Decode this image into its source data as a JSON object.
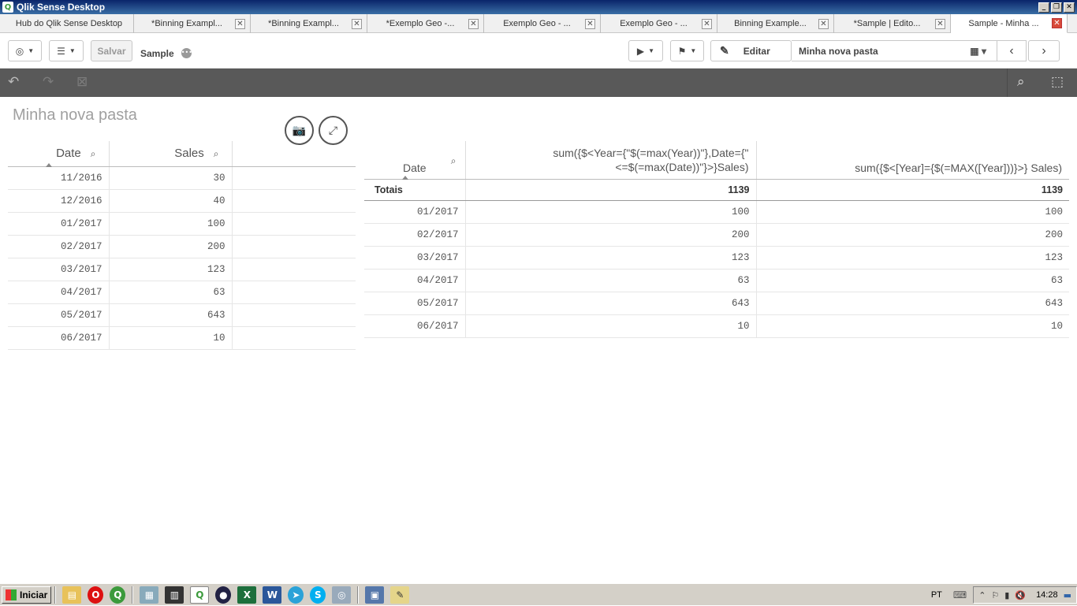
{
  "window": {
    "title": "Qlik Sense Desktop",
    "app_icon": "qlik-logo-icon"
  },
  "tabs": [
    {
      "label": "Hub do Qlik Sense Desktop",
      "closable": false,
      "active": false
    },
    {
      "label": "*Binning Exampl...",
      "closable": true,
      "active": false
    },
    {
      "label": "*Binning Exampl...",
      "closable": true,
      "active": false
    },
    {
      "label": "*Exemplo Geo -...",
      "closable": true,
      "active": false
    },
    {
      "label": "Exemplo Geo - ...",
      "closable": true,
      "active": false
    },
    {
      "label": "Exemplo Geo - ...",
      "closable": true,
      "active": false
    },
    {
      "label": "Binning Example...",
      "closable": true,
      "active": false
    },
    {
      "label": "*Sample | Edito...",
      "closable": true,
      "active": false
    },
    {
      "label": "Sample - Minha ...",
      "closable": true,
      "active": true
    }
  ],
  "toolbar": {
    "save_label": "Salvar",
    "app_name": "Sample",
    "edit_label": "Editar",
    "sheet_name": "Minha nova pasta"
  },
  "sheet": {
    "title": "Minha nova pasta"
  },
  "table1": {
    "headers": [
      "Date",
      "Sales"
    ],
    "rows": [
      [
        "11/2016",
        "30"
      ],
      [
        "12/2016",
        "40"
      ],
      [
        "01/2017",
        "100"
      ],
      [
        "02/2017",
        "200"
      ],
      [
        "03/2017",
        "123"
      ],
      [
        "04/2017",
        "63"
      ],
      [
        "05/2017",
        "643"
      ],
      [
        "06/2017",
        "10"
      ]
    ]
  },
  "table2": {
    "headers": [
      "Date",
      "sum({$<Year={\"$(=max(Year))\"},Date={\"<=$(=max(Date))\"}>}Sales)",
      "sum({$<[Year]={$(=MAX([Year]))}>} Sales)"
    ],
    "totals_label": "Totais",
    "totals": [
      "1139",
      "1139"
    ],
    "rows": [
      [
        "01/2017",
        "100",
        "100"
      ],
      [
        "02/2017",
        "200",
        "200"
      ],
      [
        "03/2017",
        "123",
        "123"
      ],
      [
        "04/2017",
        "63",
        "63"
      ],
      [
        "05/2017",
        "643",
        "643"
      ],
      [
        "06/2017",
        "10",
        "10"
      ]
    ]
  },
  "taskbar": {
    "start_label": "Iniciar",
    "language": "PT",
    "clock": "14:28"
  },
  "colors": {
    "title_bar": "#0a246a",
    "selection_bar": "#595959",
    "active_tab_close": "#d84a3a"
  }
}
